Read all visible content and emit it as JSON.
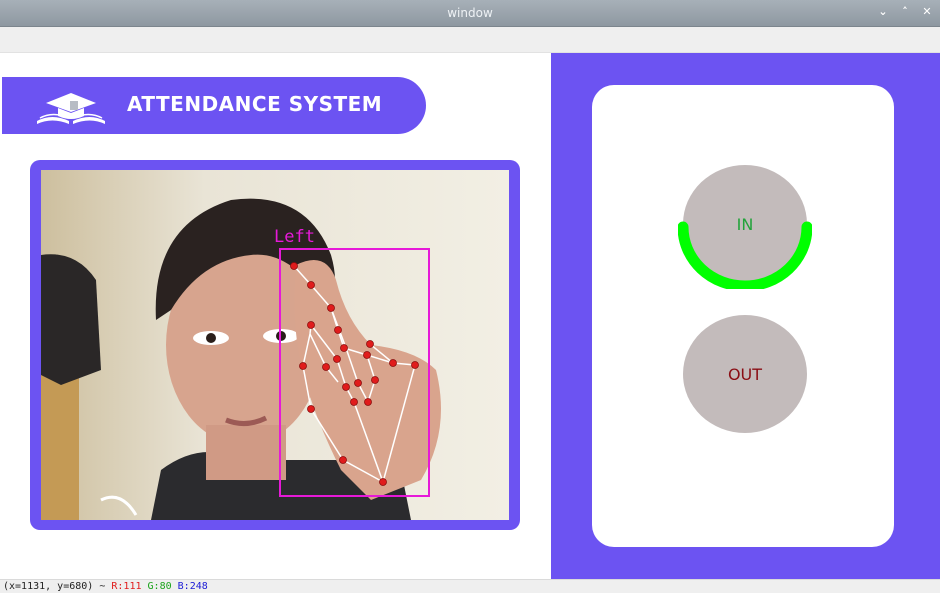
{
  "window": {
    "title": "window",
    "minimize": "⌄",
    "maximize": "˄",
    "close": "✕"
  },
  "app": {
    "banner_title": "ATTENDANCE SYSTEM",
    "accent_color": "#6c53f2",
    "camera": {
      "hand_label": "Left"
    }
  },
  "buttons": {
    "in_label": "IN",
    "out_label": "OUT",
    "in_progress": 0.5,
    "progress_color": "#00ff00"
  },
  "status": {
    "coords": "(x=1131, y=680) ~",
    "r": "R:111",
    "g": "G:80",
    "b": "B:248"
  }
}
